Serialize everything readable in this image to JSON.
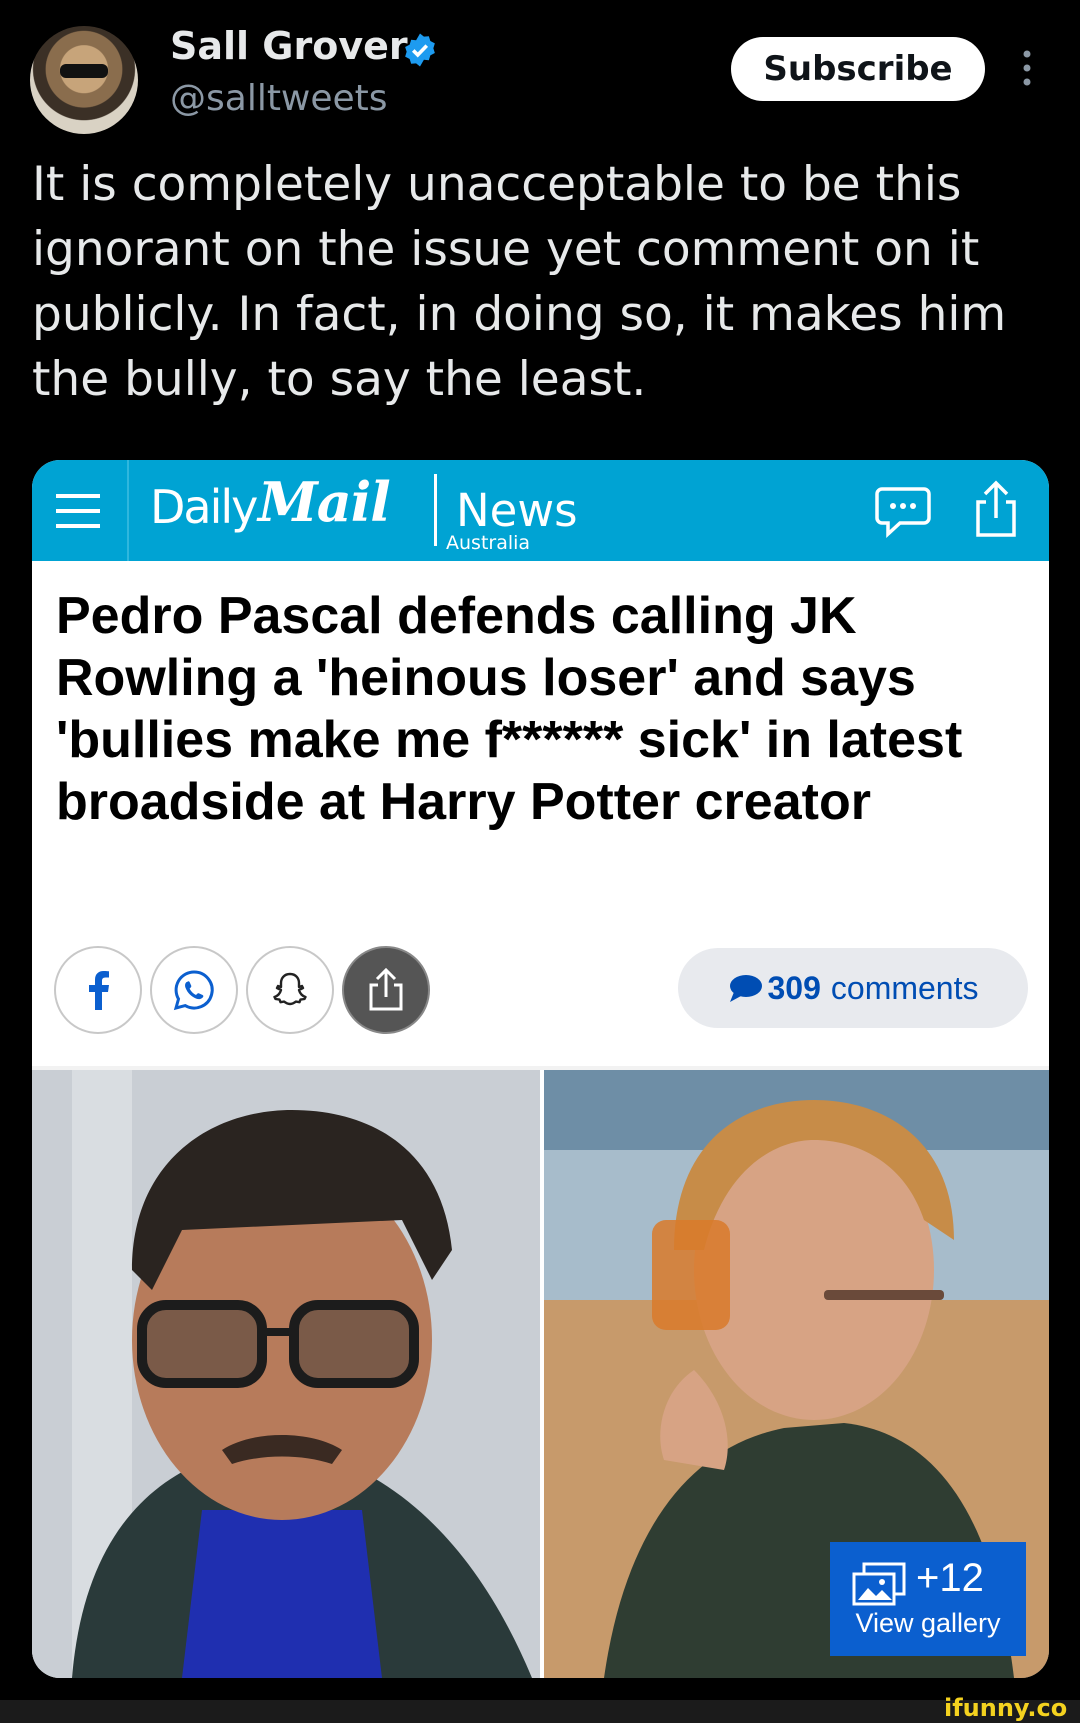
{
  "tweet": {
    "author_name": "Sall Grover",
    "handle": "@salltweets",
    "subscribe_label": "Subscribe",
    "text": "It is completely unacceptable to be this ignorant on the issue yet comment on it publicly. In fact, in doing so, it makes him the bully, to say the least."
  },
  "article": {
    "brand_daily": "Daily",
    "brand_mail": "Mail",
    "brand_region": "Australia",
    "section": "News",
    "headline": "Pedro Pascal defends calling JK Rowling a 'heinous loser' and says 'bullies make me f****** sick' in latest broadside at Harry Potter creator",
    "comments_count": "309",
    "comments_word": "comments",
    "gallery_count": "+12",
    "gallery_label": "View gallery"
  },
  "watermark": "ifunny.co",
  "colors": {
    "background": "#000000",
    "brand_bar": "#00a3d3",
    "verified": "#1d9bf0",
    "comments_text": "#004db3",
    "gallery_badge": "#0b5fcf"
  },
  "icons": [
    "verified-badge-icon",
    "more-options-icon",
    "menu-icon",
    "comment-icon",
    "share-icon",
    "facebook-icon",
    "whatsapp-icon",
    "snapchat-icon",
    "gallery-icon",
    "chevron-right-icon"
  ]
}
